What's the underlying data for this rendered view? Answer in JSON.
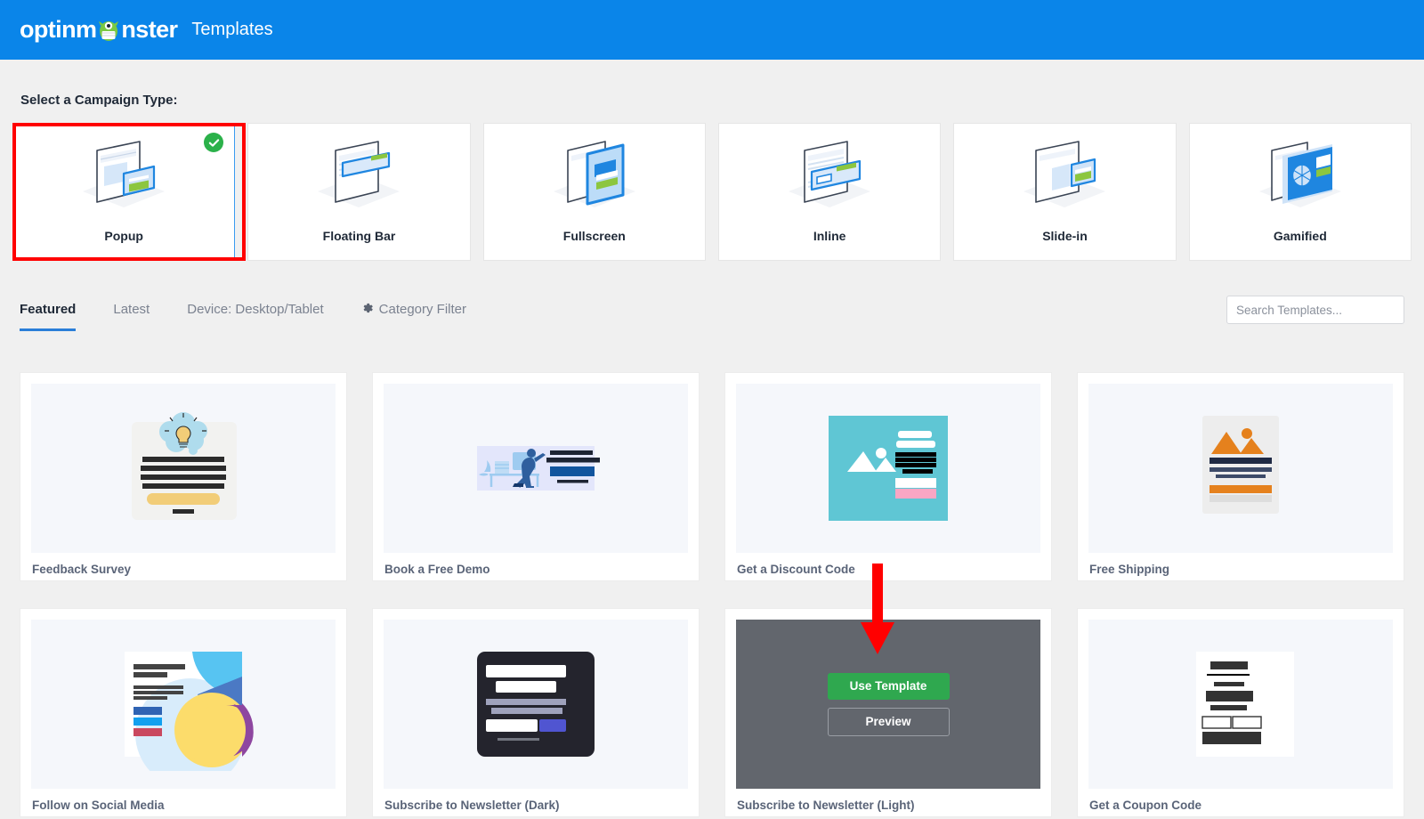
{
  "header": {
    "brand": "optinmonster",
    "brand_mark_icon": "monster-logo-icon",
    "title": "Templates",
    "bg_color": "#0a85e9"
  },
  "campaign_type": {
    "label": "Select a Campaign Type:",
    "selected": "Popup",
    "selected_badge_icon": "check-circle-icon",
    "annotation": "red-highlight-box",
    "items": [
      {
        "label": "Popup",
        "icon": "campaign-type-popup-icon",
        "selected": true
      },
      {
        "label": "Floating Bar",
        "icon": "campaign-type-floating-bar-icon",
        "selected": false
      },
      {
        "label": "Fullscreen",
        "icon": "campaign-type-fullscreen-icon",
        "selected": false
      },
      {
        "label": "Inline",
        "icon": "campaign-type-inline-icon",
        "selected": false
      },
      {
        "label": "Slide-in",
        "icon": "campaign-type-slide-in-icon",
        "selected": false
      },
      {
        "label": "Gamified",
        "icon": "campaign-type-gamified-icon",
        "selected": false
      }
    ]
  },
  "filters": {
    "tabs": [
      {
        "label": "Featured",
        "active": true
      },
      {
        "label": "Latest",
        "active": false
      },
      {
        "label": "Device: Desktop/Tablet",
        "active": false
      },
      {
        "label": "Category Filter",
        "active": false,
        "icon": "gear-icon"
      }
    ],
    "search": {
      "placeholder": "Search Templates...",
      "value": ""
    },
    "active_tab_underline_color": "#2a7ed8"
  },
  "templates": [
    {
      "title": "Feedback Survey",
      "thumb": "thought-bulb-survey-thumb"
    },
    {
      "title": "Book a Free Demo",
      "thumb": "desk-person-demo-thumb"
    },
    {
      "title": "Get a Discount Code",
      "thumb": "teal-discount-thumb"
    },
    {
      "title": "Free Shipping",
      "thumb": "orange-shipping-thumb"
    },
    {
      "title": "Follow on Social Media",
      "thumb": "colorful-social-thumb"
    },
    {
      "title": "Subscribe to Newsletter (Dark)",
      "thumb": "dark-newsletter-thumb"
    },
    {
      "title": "Subscribe to Newsletter (Light)",
      "thumb": "hover-overlay-thumb",
      "hovered": true
    },
    {
      "title": "Get a Coupon Code",
      "thumb": "coupon-code-thumb"
    }
  ],
  "hover_overlay": {
    "use_template_label": "Use Template",
    "preview_label": "Preview",
    "use_template_color": "#2fa84f",
    "overlay_color": "#62666d",
    "annotation_icon": "red-down-arrow-annotation"
  }
}
